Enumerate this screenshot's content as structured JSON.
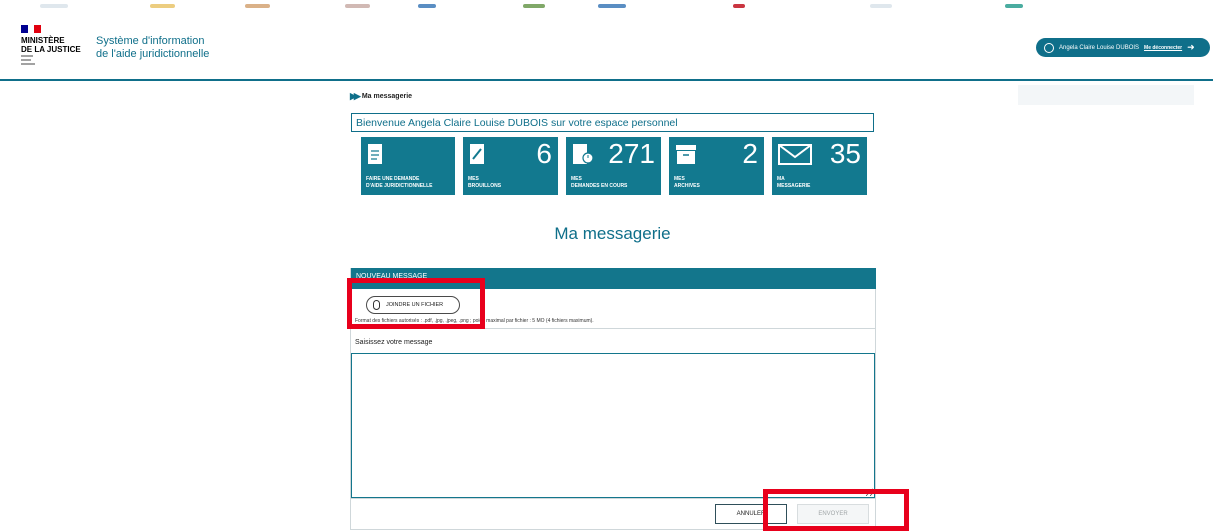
{
  "header": {
    "logo": {
      "line1": "MINISTÈRE",
      "line2": "DE LA JUSTICE"
    },
    "app_title": {
      "line1": "Système d'information",
      "line2": "de l'aide juridictionnelle"
    },
    "user": {
      "name": "Angela Claire Louise DUBOIS",
      "logout_label": "Me déconnecter",
      "icon": "user-icon",
      "logout_icon": "logout-icon"
    }
  },
  "breadcrumb": {
    "label": "Ma messagerie"
  },
  "welcome": "Bienvenue Angela Claire Louise DUBOIS sur votre espace personnel",
  "tiles": [
    {
      "icon": "document-icon",
      "count": "",
      "label1": "FAIRE UNE DEMANDE",
      "label2": "D'AIDE JURIDICTIONNELLE"
    },
    {
      "icon": "draft-icon",
      "count": "6",
      "label1": "MES",
      "label2": "BROUILLONS"
    },
    {
      "icon": "pending-document-icon",
      "count": "271",
      "label1": "MES",
      "label2": "DEMANDES EN COURS"
    },
    {
      "icon": "archive-icon",
      "count": "2",
      "label1": "MES",
      "label2": "ARCHIVES"
    },
    {
      "icon": "envelope-icon",
      "count": "35",
      "label1": "MA",
      "label2": "MESSAGERIE"
    }
  ],
  "page_title": "Ma messagerie",
  "message_form": {
    "header": "NOUVEAU MESSAGE",
    "attach_label": "JOINDRE UN FICHIER",
    "attach_icon": "paperclip-icon",
    "format_note": "Format des fichiers autorisés : .pdf, .jpg, .jpeg, .png ; poids maximal par fichier : 5 MO (4 fichiers maximum).",
    "message_label": "Saisissez votre message",
    "message_value": "",
    "cancel_label": "ANNULER",
    "send_label": "ENVOYER"
  },
  "colors": {
    "primary": "#0f6f8a",
    "tile": "#12798f",
    "highlight": "#e8001c"
  }
}
